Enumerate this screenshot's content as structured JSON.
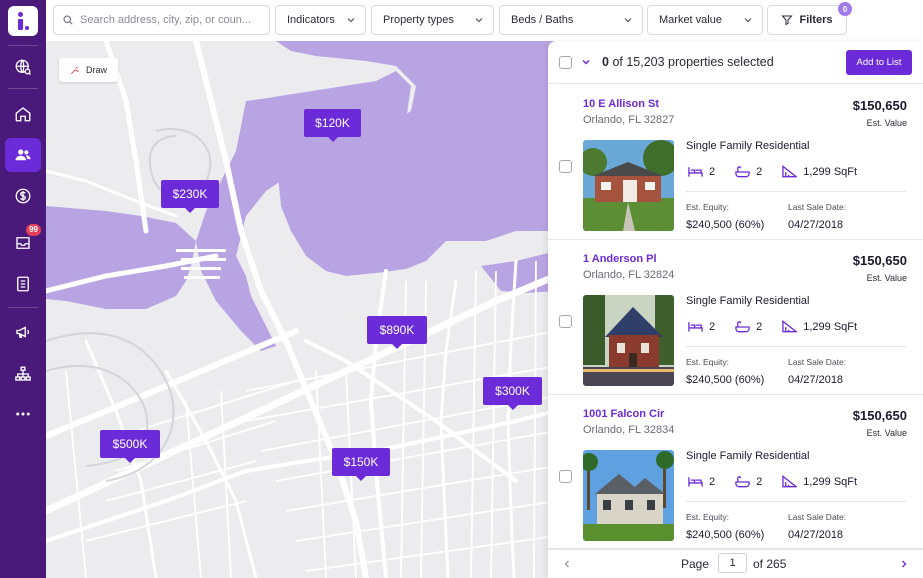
{
  "app": {
    "logo_letter": "i"
  },
  "sidebar": {
    "items": [
      {
        "name": "globe-search",
        "icon": "globe-search-icon"
      },
      {
        "name": "home",
        "icon": "home-icon"
      },
      {
        "name": "people",
        "icon": "people-icon",
        "active": true
      },
      {
        "name": "dollar",
        "icon": "dollar-icon"
      },
      {
        "name": "inbox",
        "icon": "inbox-icon",
        "badge": "99"
      },
      {
        "name": "contacts",
        "icon": "contact-card-icon"
      },
      {
        "name": "campaigns",
        "icon": "megaphone-icon"
      },
      {
        "name": "org-chart",
        "icon": "org-chart-icon"
      },
      {
        "name": "more",
        "icon": "more-icon"
      }
    ]
  },
  "topbar": {
    "search_placeholder": "Search address, city, zip, or coun...",
    "filters": [
      "Indicators",
      "Property types",
      "Beds / Baths",
      "Market value"
    ],
    "filters_button": "Filters",
    "filters_count": "0"
  },
  "map": {
    "draw_label": "Draw",
    "pins": [
      "$120K",
      "$230K",
      "$890K",
      "$300K",
      "$500K",
      "$150K"
    ]
  },
  "panel": {
    "selected_count": "0",
    "selected_suffix": "of 15,203 properties selected",
    "add_to_list": "Add to List",
    "properties": [
      {
        "address": "10 E Allison St",
        "city": "Orlando, FL 32827",
        "price": "$150,650",
        "price_label": "Est. Value",
        "type": "Single Family Residential",
        "beds": "2",
        "baths": "2",
        "sqft": "1,299 SqFt",
        "equity_label": "Est. Equity:",
        "equity": "$240,500 (60%)",
        "sale_label": "Last Sale Date:",
        "sale_date": "04/27/2018"
      },
      {
        "address": "1 Anderson Pl",
        "city": "Orlando, FL 32824",
        "price": "$150,650",
        "price_label": "Est. Value",
        "type": "Single Family Residential",
        "beds": "2",
        "baths": "2",
        "sqft": "1,299 SqFt",
        "equity_label": "Est. Equity:",
        "equity": "$240,500 (60%)",
        "sale_label": "Last Sale Date:",
        "sale_date": "04/27/2018"
      },
      {
        "address": "1001 Falcon Cir",
        "city": "Orlando, FL 32834",
        "price": "$150,650",
        "price_label": "Est. Value",
        "type": "Single Family Residential",
        "beds": "2",
        "baths": "2",
        "sqft": "1,299 SqFt",
        "equity_label": "Est. Equity:",
        "equity": "$240,500 (60%)",
        "sale_label": "Last Sale Date:",
        "sale_date": "04/27/2018"
      }
    ],
    "pager": {
      "label": "Page",
      "current": "1",
      "total": "of 265"
    }
  },
  "colors": {
    "accent": "#6c2bd9",
    "sidebar": "#4a1a7a",
    "water": "#b9a4e3",
    "map_bg": "#ececef"
  }
}
